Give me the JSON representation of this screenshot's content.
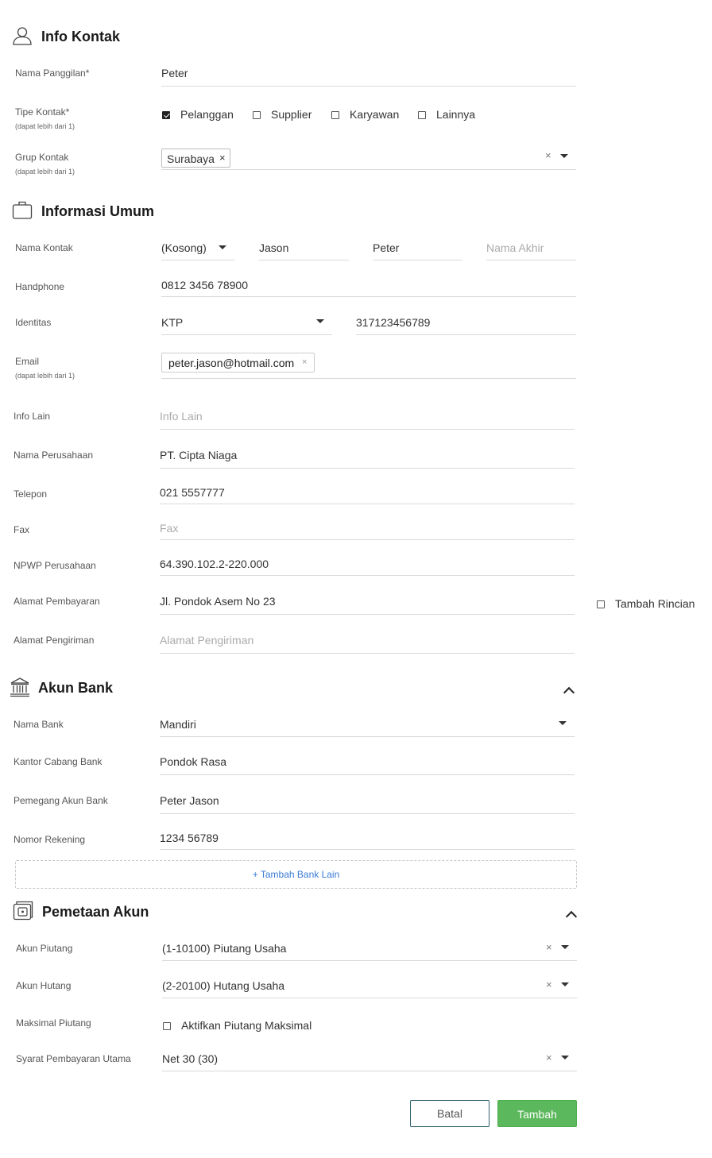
{
  "info_kontak": {
    "title": "Info Kontak",
    "nama_panggilan": {
      "label": "Nama Panggilan*",
      "value": "Peter"
    },
    "tipe_kontak": {
      "label": "Tipe Kontak*",
      "sub": "(dapat lebih dari 1)",
      "options": [
        {
          "label": "Pelanggan",
          "checked": true
        },
        {
          "label": "Supplier",
          "checked": false
        },
        {
          "label": "Karyawan",
          "checked": false
        },
        {
          "label": "Lainnya",
          "checked": false
        }
      ]
    },
    "grup_kontak": {
      "label": "Grup Kontak",
      "sub": "(dapat lebih dari 1)",
      "tag": "Surabaya",
      "tag_remove": "×",
      "clear": "×"
    }
  },
  "informasi_umum": {
    "title": "Informasi Umum",
    "nama_kontak": {
      "label": "Nama Kontak",
      "salutation": "(Kosong)",
      "first": "Jason",
      "middle": "Peter",
      "last_placeholder": "Nama Akhir"
    },
    "handphone": {
      "label": "Handphone",
      "value": "0812 3456 78900"
    },
    "identitas": {
      "label": "Identitas",
      "type": "KTP",
      "number": "317123456789"
    },
    "email": {
      "label": "Email",
      "sub": "(dapat lebih dari 1)",
      "tag": "peter.jason@hotmail.com",
      "tag_remove": "×"
    },
    "info_lain": {
      "label": "Info Lain",
      "placeholder": "Info Lain"
    },
    "nama_perusahaan": {
      "label": "Nama Perusahaan",
      "value": "PT. Cipta Niaga"
    },
    "telepon": {
      "label": "Telepon",
      "value": "021 5557777"
    },
    "fax": {
      "label": "Fax",
      "placeholder": "Fax"
    },
    "npwp": {
      "label": "NPWP Perusahaan",
      "value": "64.390.102.2-220.000"
    },
    "alamat_pembayaran": {
      "label": "Alamat Pembayaran",
      "value": "Jl. Pondok Asem No 23"
    },
    "tambah_rincian": {
      "label": "Tambah Rincian",
      "checked": false
    },
    "alamat_pengiriman": {
      "label": "Alamat Pengiriman",
      "placeholder": "Alamat Pengiriman"
    }
  },
  "akun_bank": {
    "title": "Akun Bank",
    "nama_bank": {
      "label": "Nama Bank",
      "value": "Mandiri"
    },
    "kantor_cabang": {
      "label": "Kantor Cabang Bank",
      "value": "Pondok Rasa"
    },
    "pemegang": {
      "label": "Pemegang Akun Bank",
      "value": "Peter Jason"
    },
    "nomor_rekening": {
      "label": "Nomor Rekening",
      "value": "1234 56789"
    },
    "add_bank": "+ Tambah Bank Lain"
  },
  "pemetaan_akun": {
    "title": "Pemetaan Akun",
    "akun_piutang": {
      "label": "Akun Piutang",
      "value": "(1-10100) Piutang Usaha",
      "clear": "×"
    },
    "akun_hutang": {
      "label": "Akun Hutang",
      "value": "(2-20100) Hutang Usaha",
      "clear": "×"
    },
    "maksimal_piutang": {
      "label": "Maksimal Piutang",
      "checkbox_label": "Aktifkan Piutang Maksimal",
      "checked": false
    },
    "syarat": {
      "label": "Syarat Pembayaran Utama",
      "value": "Net 30 (30)",
      "clear": "×"
    }
  },
  "actions": {
    "cancel": "Batal",
    "submit": "Tambah"
  },
  "colors": {
    "submit_bg": "#5cb85c",
    "cancel_border": "#2f5f6f",
    "link": "#3a7bd5"
  }
}
